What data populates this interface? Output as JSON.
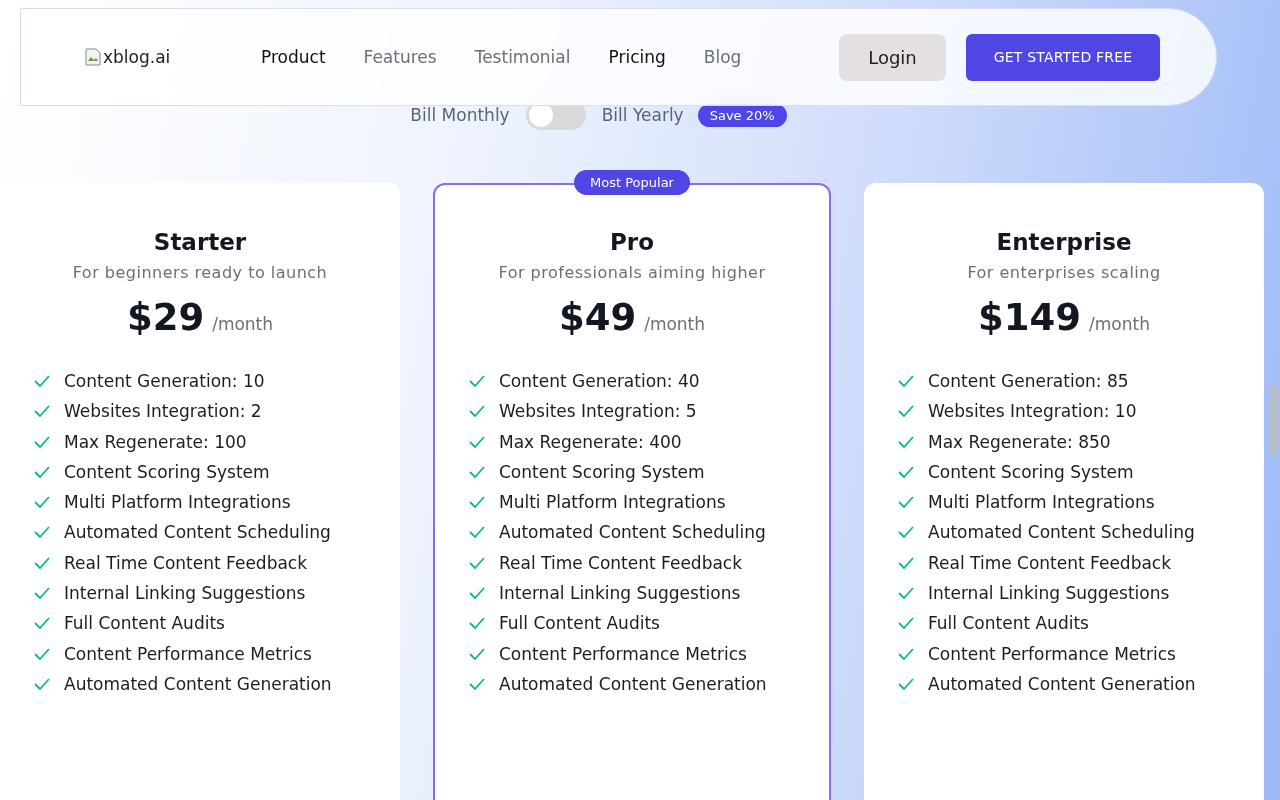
{
  "nav": {
    "logo": "xblog.ai",
    "links": [
      {
        "label": "Product",
        "selected": true
      },
      {
        "label": "Features",
        "selected": false
      },
      {
        "label": "Testimonial",
        "selected": false
      },
      {
        "label": "Pricing",
        "selected": true
      },
      {
        "label": "Blog",
        "selected": false
      }
    ],
    "login": "Login",
    "cta": "GET STARTED FREE"
  },
  "billing": {
    "monthly": "Bill Monthly",
    "yearly": "Bill Yearly",
    "on": false,
    "badge": "Save 20%"
  },
  "plans": [
    {
      "name": "Starter",
      "tagline": "For beginners ready to launch",
      "price": "$29",
      "period": "/month",
      "popular": false,
      "features": [
        "Content Generation: 10",
        "Websites Integration: 2",
        "Max Regenerate: 100",
        "Content Scoring System",
        "Multi Platform Integrations",
        "Automated Content Scheduling",
        "Real Time Content Feedback",
        "Internal Linking Suggestions",
        "Full Content Audits",
        "Content Performance Metrics",
        "Automated Content Generation"
      ]
    },
    {
      "name": "Pro",
      "tagline": "For professionals aiming higher",
      "price": "$49",
      "period": "/month",
      "popular": true,
      "badge": "Most Popular",
      "features": [
        "Content Generation: 40",
        "Websites Integration: 5",
        "Max Regenerate: 400",
        "Content Scoring System",
        "Multi Platform Integrations",
        "Automated Content Scheduling",
        "Real Time Content Feedback",
        "Internal Linking Suggestions",
        "Full Content Audits",
        "Content Performance Metrics",
        "Automated Content Generation"
      ]
    },
    {
      "name": "Enterprise",
      "tagline": "For enterprises scaling",
      "price": "$149",
      "period": "/month",
      "popular": false,
      "features": [
        "Content Generation: 85",
        "Websites Integration: 10",
        "Max Regenerate: 850",
        "Content Scoring System",
        "Multi Platform Integrations",
        "Automated Content Scheduling",
        "Real Time Content Feedback",
        "Internal Linking Suggestions",
        "Full Content Audits",
        "Content Performance Metrics",
        "Automated Content Generation"
      ]
    }
  ]
}
